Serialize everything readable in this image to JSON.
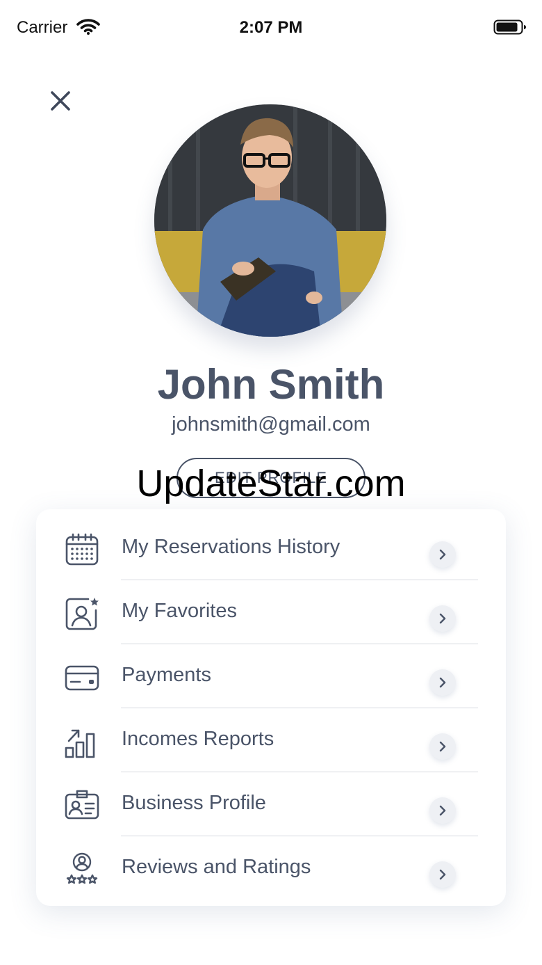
{
  "status_bar": {
    "carrier": "Carrier",
    "time": "2:07 PM"
  },
  "close_icon": "close-icon",
  "profile": {
    "name": "John Smith",
    "email": "johnsmith@gmail.com",
    "edit_button_label": "EDIT PROFILE"
  },
  "watermark": "UpdateStar.com",
  "menu": {
    "items": [
      {
        "label": "My Reservations History",
        "icon": "calendar-icon"
      },
      {
        "label": "My Favorites",
        "icon": "favorite-user-icon"
      },
      {
        "label": "Payments",
        "icon": "credit-card-icon"
      },
      {
        "label": "Incomes Reports",
        "icon": "bar-chart-growth-icon"
      },
      {
        "label": "Business Profile",
        "icon": "id-badge-icon"
      },
      {
        "label": "Reviews and Ratings",
        "icon": "user-stars-icon"
      }
    ]
  },
  "colors": {
    "primary_text": "#4a5468",
    "divider": "#d6d9df",
    "chevron_bg": "#eef0f4"
  }
}
